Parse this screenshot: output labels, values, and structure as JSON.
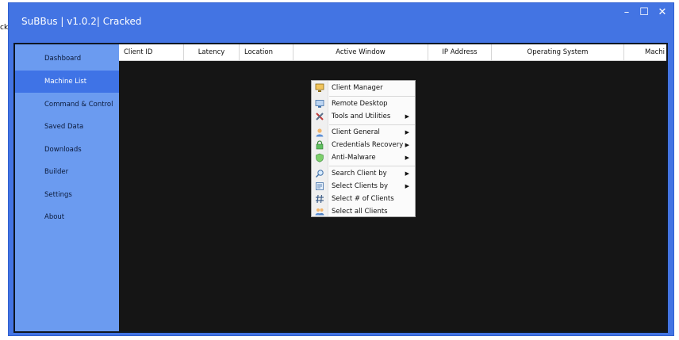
{
  "edge_text": "ck",
  "window": {
    "title": "SuBBus | v1.0.2| Cracked",
    "controls": {
      "minimize": "–",
      "maximize": "☐",
      "close": "✕"
    }
  },
  "sidebar": {
    "items": [
      {
        "label": "Dashboard",
        "active": false
      },
      {
        "label": "Machine List",
        "active": true
      },
      {
        "label": "Command & Control",
        "active": false
      },
      {
        "label": "Saved Data",
        "active": false
      },
      {
        "label": "Downloads",
        "active": false
      },
      {
        "label": "Builder",
        "active": false
      },
      {
        "label": "Settings",
        "active": false
      },
      {
        "label": "About",
        "active": false
      }
    ]
  },
  "table": {
    "columns": [
      "Client ID",
      "Latency",
      "Location",
      "Active Window",
      "IP Address",
      "Operating System",
      "Machi"
    ]
  },
  "context_menu": {
    "items": [
      {
        "label": "Client Manager",
        "icon": "monitor-icon",
        "submenu": false
      },
      {
        "label": "Remote Desktop",
        "icon": "desktop-icon",
        "submenu": false
      },
      {
        "label": "Tools and Utilities",
        "icon": "tools-icon",
        "submenu": true
      },
      {
        "label": "Client General",
        "icon": "user-icon",
        "submenu": true
      },
      {
        "label": "Credentials Recovery",
        "icon": "lock-icon",
        "submenu": true
      },
      {
        "label": "Anti-Malware",
        "icon": "shield-icon",
        "submenu": true
      },
      {
        "label": "Search Client by",
        "icon": "search-icon",
        "submenu": true
      },
      {
        "label": "Select Clients by",
        "icon": "select-list-icon",
        "submenu": true
      },
      {
        "label": "Select # of Clients",
        "icon": "hash-icon",
        "submenu": false
      },
      {
        "label": "Select all Clients",
        "icon": "group-icon",
        "submenu": false
      }
    ]
  },
  "colors": {
    "window_blue": "#4374e3",
    "sidebar_blue": "#6b9bf0",
    "active_blue": "#3f73e6",
    "main_bg": "#151515"
  }
}
